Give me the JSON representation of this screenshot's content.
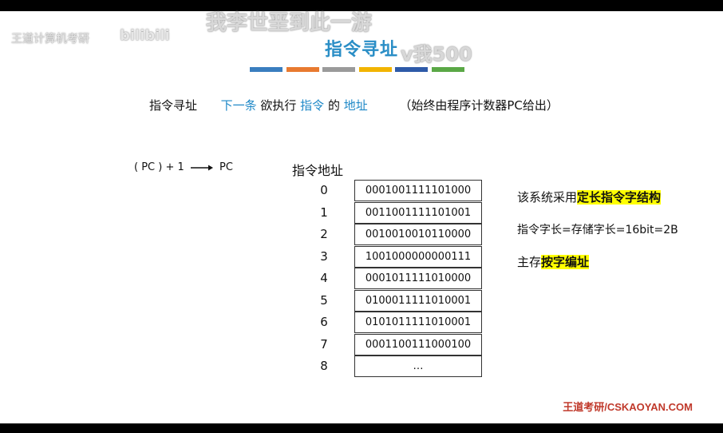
{
  "slide": {
    "title": "指令寻址",
    "color_bars": [
      "#3a7ebf",
      "#e87a30",
      "#9a9a9a",
      "#f2b400",
      "#2e5aa8",
      "#5aa846"
    ],
    "definition": {
      "term": "指令寻址",
      "part1": "下一条",
      "part2": "欲执行",
      "part3": "指令",
      "part4": "的",
      "part5": "地址",
      "note": "（始终由程序计数器PC给出）"
    },
    "formula": {
      "left": "( PC ) + 1",
      "right": "PC"
    },
    "table": {
      "header": "指令地址",
      "rows": [
        {
          "addr": "0",
          "code": "0001001111101000"
        },
        {
          "addr": "1",
          "code": "0011001111101001"
        },
        {
          "addr": "2",
          "code": "0010010010110000"
        },
        {
          "addr": "3",
          "code": "1001000000000111"
        },
        {
          "addr": "4",
          "code": "0001011111010000"
        },
        {
          "addr": "5",
          "code": "0100011111010001"
        },
        {
          "addr": "6",
          "code": "0101011111010001"
        },
        {
          "addr": "7",
          "code": "0001100111000100"
        },
        {
          "addr": "8",
          "code": "…"
        }
      ]
    },
    "notes": {
      "line1_prefix": "该系统采用",
      "line1_highlight": "定长指令字结构",
      "line2": "指令字长=存储字长=16bit=2B",
      "line3_prefix": "主存",
      "line3_highlight": "按字编址"
    },
    "footer": "王道考研/CSKAOYAN.COM"
  },
  "overlay": {
    "danmaku_top": "我李世垩到此一游",
    "danmaku_mid": "v我500",
    "watermark_left": "王道计算机考研",
    "watermark_logo": "bilibili"
  }
}
